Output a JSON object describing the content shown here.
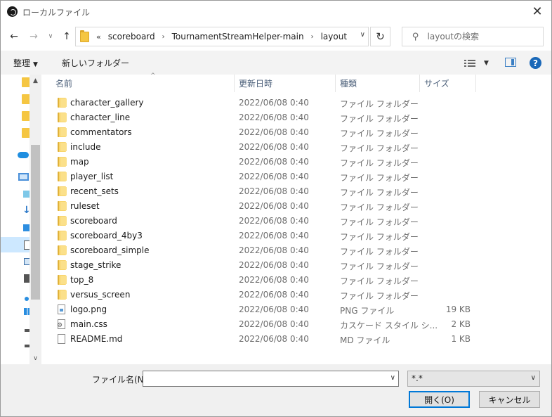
{
  "window": {
    "title": "ローカルファイル"
  },
  "nav": {
    "breadcrumb": [
      "scoreboard",
      "TournamentStreamHelper-main",
      "layout"
    ],
    "search_placeholder": "layoutの検索"
  },
  "toolbar": {
    "organize_label": "整理",
    "new_folder_label": "新しいフォルダー"
  },
  "columns": {
    "name": "名前",
    "date": "更新日時",
    "type": "種類",
    "size": "サイズ"
  },
  "files": [
    {
      "name": "character_gallery",
      "date": "2022/06/08 0:40",
      "type": "ファイル フォルダー",
      "size": "",
      "icon": "folder-icon"
    },
    {
      "name": "character_line",
      "date": "2022/06/08 0:40",
      "type": "ファイル フォルダー",
      "size": "",
      "icon": "folder-icon"
    },
    {
      "name": "commentators",
      "date": "2022/06/08 0:40",
      "type": "ファイル フォルダー",
      "size": "",
      "icon": "folder-icon"
    },
    {
      "name": "include",
      "date": "2022/06/08 0:40",
      "type": "ファイル フォルダー",
      "size": "",
      "icon": "folder-icon"
    },
    {
      "name": "map",
      "date": "2022/06/08 0:40",
      "type": "ファイル フォルダー",
      "size": "",
      "icon": "folder-icon"
    },
    {
      "name": "player_list",
      "date": "2022/06/08 0:40",
      "type": "ファイル フォルダー",
      "size": "",
      "icon": "folder-icon"
    },
    {
      "name": "recent_sets",
      "date": "2022/06/08 0:40",
      "type": "ファイル フォルダー",
      "size": "",
      "icon": "folder-icon"
    },
    {
      "name": "ruleset",
      "date": "2022/06/08 0:40",
      "type": "ファイル フォルダー",
      "size": "",
      "icon": "folder-icon"
    },
    {
      "name": "scoreboard",
      "date": "2022/06/08 0:40",
      "type": "ファイル フォルダー",
      "size": "",
      "icon": "folder-icon"
    },
    {
      "name": "scoreboard_4by3",
      "date": "2022/06/08 0:40",
      "type": "ファイル フォルダー",
      "size": "",
      "icon": "folder-icon"
    },
    {
      "name": "scoreboard_simple",
      "date": "2022/06/08 0:40",
      "type": "ファイル フォルダー",
      "size": "",
      "icon": "folder-icon"
    },
    {
      "name": "stage_strike",
      "date": "2022/06/08 0:40",
      "type": "ファイル フォルダー",
      "size": "",
      "icon": "folder-icon"
    },
    {
      "name": "top_8",
      "date": "2022/06/08 0:40",
      "type": "ファイル フォルダー",
      "size": "",
      "icon": "folder-icon"
    },
    {
      "name": "versus_screen",
      "date": "2022/06/08 0:40",
      "type": "ファイル フォルダー",
      "size": "",
      "icon": "folder-icon"
    },
    {
      "name": "logo.png",
      "date": "2022/06/08 0:40",
      "type": "PNG ファイル",
      "size": "19 KB",
      "icon": "png-file-icon"
    },
    {
      "name": "main.css",
      "date": "2022/06/08 0:40",
      "type": "カスケード スタイル シ...",
      "size": "2 KB",
      "icon": "css-file-icon"
    },
    {
      "name": "README.md",
      "date": "2022/06/08 0:40",
      "type": "MD ファイル",
      "size": "1 KB",
      "icon": "md-file-icon"
    }
  ],
  "bottom": {
    "filename_label": "ファイル名(N):",
    "filename_value": "",
    "filter_value": "*.*",
    "open_label": "開く(O)",
    "cancel_label": "キャンセル"
  },
  "colors": {
    "accent": "#0078d7",
    "folder": "#f8d46a",
    "selection": "#cde8ff"
  }
}
